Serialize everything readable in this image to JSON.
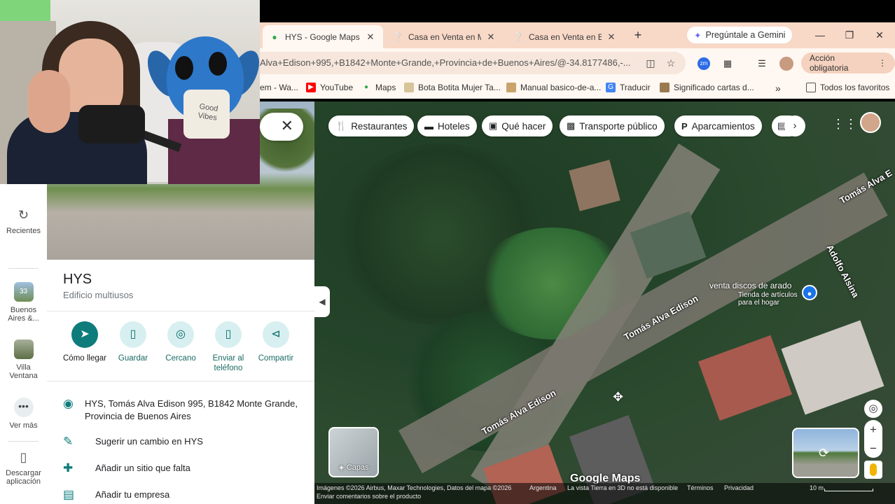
{
  "browser": {
    "tabs": [
      {
        "title": "HYS - Google Maps",
        "icon": "maps-pin-icon",
        "active": true
      },
      {
        "title": "Casa en Venta en Mo",
        "icon": "property-icon",
        "active": false
      },
      {
        "title": "Casa en Venta en Ban",
        "icon": "property-icon",
        "active": false
      }
    ],
    "gemini_label": "Pregúntale a Gemini",
    "url": "Alva+Edison+995,+B1842+Monte+Grande,+Provincia+de+Buenos+Aires/@-34.8177486,-...",
    "action_label": "Acción obligatoria",
    "ext_zm": "zm",
    "bookmarks": [
      "em - Wa...",
      "YouTube",
      "Maps",
      "Bota Botita Mujer Ta...",
      "Manual basico-de-a...",
      "Traducir",
      "Significado cartas d..."
    ],
    "all_bookmarks": "Todos los favoritos"
  },
  "webcam": {
    "shirt_text": "Good Vibes"
  },
  "rail": {
    "items": [
      "Recientes",
      "Buenos Aires &...",
      "Villa Ventana",
      "Ver más",
      "Descargar aplicación"
    ],
    "badge": "33"
  },
  "place": {
    "name": "HYS",
    "type": "Edificio multiusos",
    "actions": [
      "Cómo llegar",
      "Guardar",
      "Cercano",
      "Enviar al teléfono",
      "Compartir"
    ],
    "address": "HYS, Tomás Alva Edison 995, B1842 Monte Grande, Provincia de Buenos Aires",
    "suggest": "Sugerir un cambio en HYS",
    "add_place": "Añadir un sitio que falta",
    "add_business": "Añadir tu empresa"
  },
  "map": {
    "chips": [
      "Restaurantes",
      "Hoteles",
      "Qué hacer",
      "Transporte público",
      "Aparcamientos"
    ],
    "streets": [
      "Tomás Alva Edison",
      "Tomás Alva Edison",
      "Tomás Alva E",
      "Adolfo Alsina"
    ],
    "poi_name": "venta discos de arado",
    "poi_sub": "Tienda de artículos para el hogar",
    "layers_label": "Capas",
    "logo": "Google Maps",
    "footer": {
      "imagery": "Imágenes ©2026 Airbus, Maxar Technologies, Datos del mapa ©2026",
      "country": "Argentina",
      "view3d": "La vista Tierra en 3D no está disponible",
      "terms": "Términos",
      "privacy": "Privacidad",
      "scale": "10 m",
      "feedback": "Enviar comentarios sobre el producto"
    }
  }
}
